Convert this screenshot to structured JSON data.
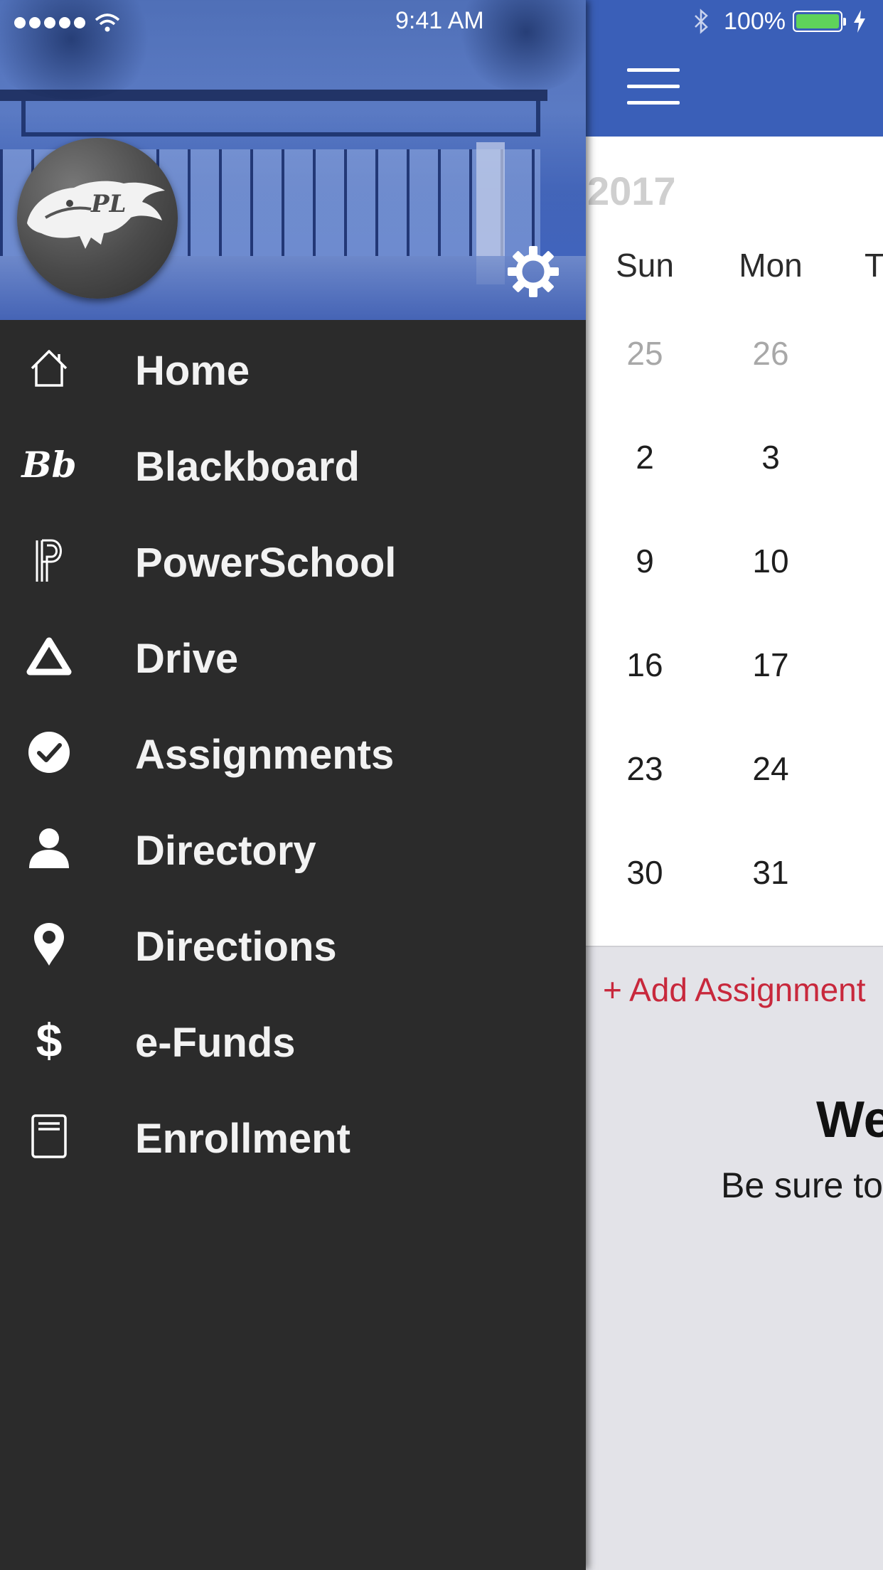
{
  "status_bar": {
    "time": "9:41 AM",
    "battery": "100%"
  },
  "drawer": {
    "items": [
      {
        "label": "Home",
        "icon": "home-icon"
      },
      {
        "label": "Blackboard",
        "icon": "blackboard-icon",
        "glyph": "Bb"
      },
      {
        "label": "PowerSchool",
        "icon": "powerschool-icon"
      },
      {
        "label": "Drive",
        "icon": "drive-icon"
      },
      {
        "label": "Assignments",
        "icon": "checkmark-circle-icon"
      },
      {
        "label": "Directory",
        "icon": "person-icon"
      },
      {
        "label": "Directions",
        "icon": "map-pin-icon"
      },
      {
        "label": "e-Funds",
        "icon": "dollar-icon",
        "glyph": "$"
      },
      {
        "label": "Enrollment",
        "icon": "book-icon"
      }
    ]
  },
  "calendar": {
    "year": "2017",
    "weekdays": [
      "Sun",
      "Mon",
      "T"
    ],
    "weeks": [
      [
        "25",
        "26"
      ],
      [
        "2",
        "3"
      ],
      [
        "9",
        "10"
      ],
      [
        "16",
        "17"
      ],
      [
        "23",
        "24"
      ],
      [
        "30",
        "31"
      ]
    ]
  },
  "main": {
    "add_assignment": "+ Add Assignment",
    "welcome_title": "We",
    "welcome_subtitle": "Be sure to"
  },
  "colors": {
    "nav_blue": "#3a5fb8",
    "drawer_bg": "#2b2b2b",
    "accent_red": "#c8283c",
    "battery_green": "#5fd35a"
  }
}
